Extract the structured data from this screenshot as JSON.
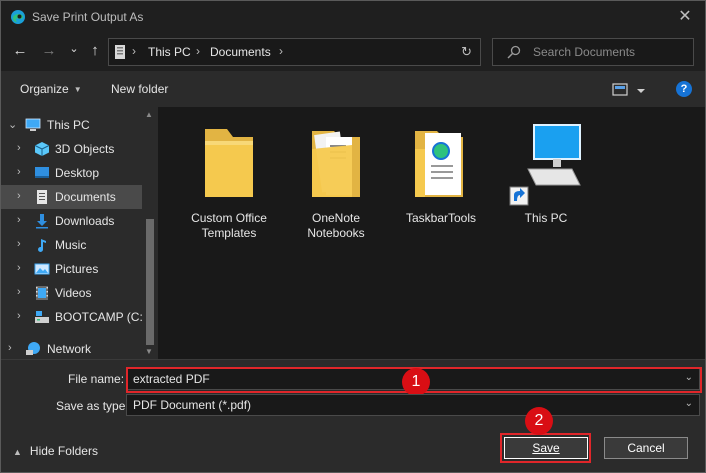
{
  "window": {
    "title": "Save Print Output As",
    "close_glyph": "✕"
  },
  "nav": {
    "back": "←",
    "forward": "→",
    "recent": "⌄",
    "up": "↑"
  },
  "address": {
    "crumbs": [
      "This PC",
      "Documents"
    ],
    "separator": "›",
    "refresh": "↻"
  },
  "search": {
    "placeholder": "Search Documents"
  },
  "toolbar": {
    "organize": "Organize",
    "new_folder": "New folder",
    "help": "?"
  },
  "sidebar": {
    "items": [
      {
        "label": "This PC",
        "icon": "computer-icon"
      },
      {
        "label": "3D Objects",
        "icon": "cube-icon"
      },
      {
        "label": "Desktop",
        "icon": "desktop-icon"
      },
      {
        "label": "Documents",
        "icon": "document-icon",
        "selected": true
      },
      {
        "label": "Downloads",
        "icon": "download-icon"
      },
      {
        "label": "Music",
        "icon": "music-icon"
      },
      {
        "label": "Pictures",
        "icon": "picture-icon"
      },
      {
        "label": "Videos",
        "icon": "video-icon"
      },
      {
        "label": "BOOTCAMP (C:)",
        "icon": "drive-icon"
      },
      {
        "label": "Network",
        "icon": "network-icon"
      }
    ]
  },
  "files": [
    {
      "name": "Custom Office\nTemplates",
      "type": "folder"
    },
    {
      "name": "OneNote\nNotebooks",
      "type": "folder-docs"
    },
    {
      "name": "TaskbarTools",
      "type": "folder-web"
    },
    {
      "name": "This PC",
      "type": "shortcut-pc"
    }
  ],
  "form": {
    "file_name_label": "File name:",
    "file_name_value": "extracted PDF",
    "save_type_label": "Save as type:",
    "save_type_value": "PDF Document (*.pdf)"
  },
  "annotations": {
    "step1": "1",
    "step2": "2",
    "color": "#e0262a"
  },
  "footer": {
    "hide_folders": "Hide Folders",
    "save": "Save",
    "cancel": "Cancel"
  },
  "colors": {
    "accent": "#1673d6",
    "folder": "#f5c94e"
  }
}
